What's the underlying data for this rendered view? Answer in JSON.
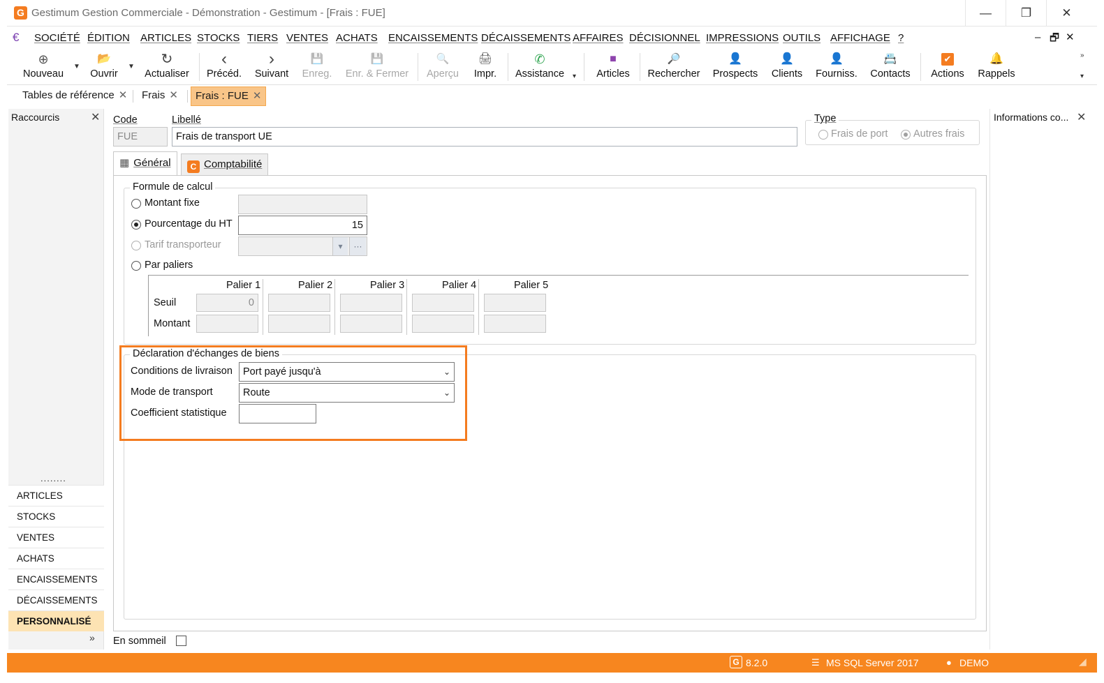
{
  "window": {
    "title": "Gestimum Gestion Commerciale - Démonstration - Gestimum - [Frais : FUE]",
    "logo_letter": "G",
    "minimize": "—",
    "restore": "❐",
    "close": "✕"
  },
  "menubar": {
    "euro_icon": "€",
    "items": [
      "SOCIÉTÉ",
      "ÉDITION",
      "ARTICLES",
      "STOCKS",
      "TIERS",
      "VENTES",
      "ACHATS",
      "ENCAISSEMENTS",
      "DÉCAISSEMENTS",
      "AFFAIRES",
      "DÉCISIONNEL",
      "IMPRESSIONS",
      "OUTILS",
      "AFFICHAGE",
      "?"
    ],
    "mdi_controls": [
      "–",
      "🗗",
      "✕"
    ]
  },
  "toolbar": {
    "buttons": [
      {
        "label": "Nouveau",
        "icon": "plus-circle-icon",
        "glyph": "⊕",
        "enabled": true
      },
      {
        "label": "Ouvrir",
        "icon": "folder-open-icon",
        "glyph": "📂",
        "enabled": true
      },
      {
        "label": "Actualiser",
        "icon": "refresh-icon",
        "glyph": "↻",
        "enabled": true
      },
      {
        "label": "Précéd.",
        "icon": "chevron-left-icon",
        "glyph": "‹",
        "enabled": true
      },
      {
        "label": "Suivant",
        "icon": "chevron-right-icon",
        "glyph": "›",
        "enabled": true
      },
      {
        "label": "Enreg.",
        "icon": "save-icon",
        "glyph": "💾",
        "enabled": false
      },
      {
        "label": "Enr. & Fermer",
        "icon": "save-close-icon",
        "glyph": "💾",
        "enabled": false
      },
      {
        "label": "Aperçu",
        "icon": "preview-icon",
        "glyph": "🔍",
        "enabled": false
      },
      {
        "label": "Impr.",
        "icon": "printer-icon",
        "glyph": "🖨",
        "enabled": true
      },
      {
        "label": "Assistance",
        "icon": "whatsapp-icon",
        "glyph": "✆",
        "enabled": true
      },
      {
        "label": "Articles",
        "icon": "articles-icon",
        "glyph": "■",
        "enabled": true
      },
      {
        "label": "Rechercher",
        "icon": "search-people-icon",
        "glyph": "🔎",
        "enabled": true
      },
      {
        "label": "Prospects",
        "icon": "prospects-icon",
        "glyph": "👤",
        "enabled": true
      },
      {
        "label": "Clients",
        "icon": "clients-icon",
        "glyph": "👤",
        "enabled": true
      },
      {
        "label": "Fourniss.",
        "icon": "suppliers-icon",
        "glyph": "👤",
        "enabled": true
      },
      {
        "label": "Contacts",
        "icon": "contacts-icon",
        "glyph": "📇",
        "enabled": true
      },
      {
        "label": "Actions",
        "icon": "actions-check-icon",
        "glyph": "✔",
        "enabled": true
      },
      {
        "label": "Rappels",
        "icon": "bell-icon",
        "glyph": "🔔",
        "enabled": true
      }
    ]
  },
  "doc_tabs": [
    {
      "label": "Tables de référence",
      "active": false
    },
    {
      "label": "Frais",
      "active": false
    },
    {
      "label": "Frais : FUE",
      "active": true
    }
  ],
  "sidebar": {
    "title": "Raccourcis",
    "dots": "........",
    "items": [
      "ARTICLES",
      "STOCKS",
      "VENTES",
      "ACHATS",
      "ENCAISSEMENTS",
      "DÉCAISSEMENTS",
      "PERSONNALISÉ"
    ],
    "active_index": 6,
    "expand": "»"
  },
  "right_panel": {
    "title": "Informations co..."
  },
  "form": {
    "code_label": "Code",
    "code_value": "FUE",
    "libelle_label": "Libellé",
    "libelle_value": "Frais de transport UE",
    "type": {
      "title": "Type",
      "options": [
        "Frais de port",
        "Autres frais"
      ],
      "selected": "Autres frais"
    },
    "tabs": [
      {
        "label": "Général",
        "icon": "calculator-icon",
        "active": true
      },
      {
        "label": "Comptabilité",
        "icon": "gestimum-c-icon",
        "active": false
      }
    ],
    "formule": {
      "title": "Formule de calcul",
      "montant_fixe_label": "Montant fixe",
      "pourcentage_label": "Pourcentage du HT",
      "pourcentage_value": "15",
      "tarif_label": "Tarif transporteur",
      "paliers_label": "Par paliers",
      "selected": "Pourcentage du HT",
      "paliers": {
        "headers": [
          "Palier 1",
          "Palier 2",
          "Palier 3",
          "Palier 4",
          "Palier 5"
        ],
        "row_labels": [
          "Seuil",
          "Montant"
        ],
        "seuil_values": [
          "0",
          "",
          "",
          "",
          ""
        ],
        "montant_values": [
          "",
          "",
          "",
          "",
          ""
        ]
      }
    },
    "deb": {
      "title": "Déclaration d'échanges de biens",
      "conditions_label": "Conditions de livraison",
      "conditions_value": "Port payé jusqu'à",
      "mode_label": "Mode de transport",
      "mode_value": "Route",
      "coefficient_label": "Coefficient statistique",
      "coefficient_value": ""
    },
    "en_sommeil_label": "En sommeil",
    "en_sommeil_checked": false
  },
  "statusbar": {
    "version": "8.2.0",
    "database": "MS SQL Server 2017",
    "user": "DEMO"
  },
  "colors": {
    "accent": "#f47c20",
    "status_bar": "#f7861f",
    "active_tab": "#f9c588",
    "sidebar_active": "#fde3b3"
  }
}
